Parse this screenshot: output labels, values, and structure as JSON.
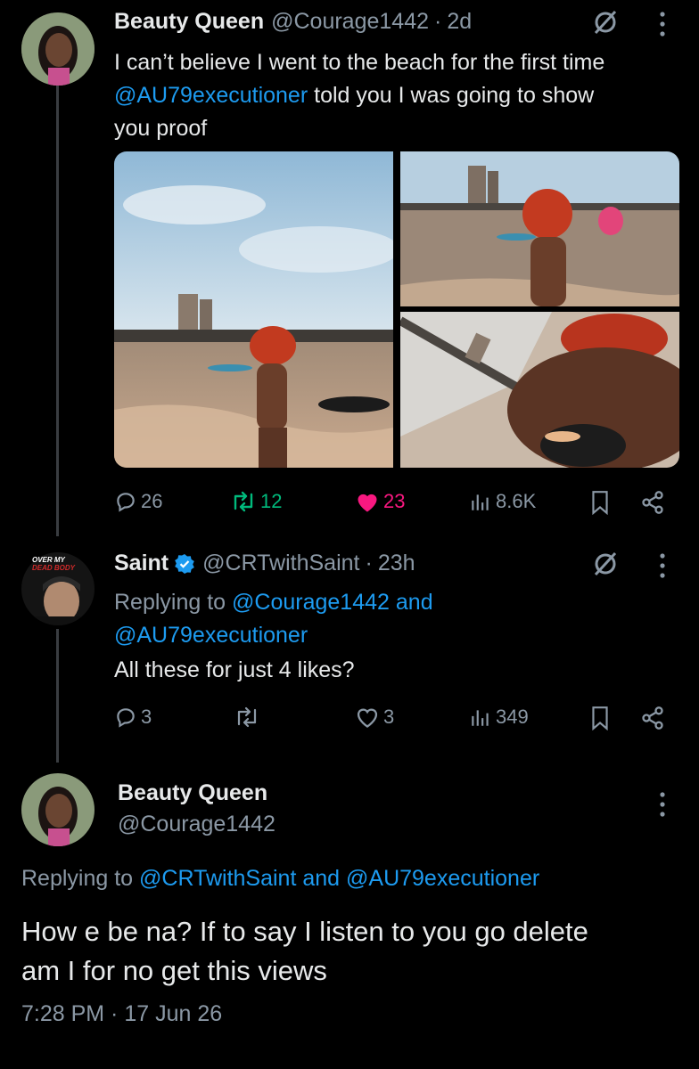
{
  "tweet1": {
    "name": "Beauty Queen",
    "handle": "@Courage1442",
    "dot": "·",
    "time": "2d",
    "text_line1": "I can’t believe I went to the beach for the first time",
    "mention": "@AU79executioner",
    "text_line2_rest": " told you I was going to show",
    "text_line3": "you proof",
    "replies": "26",
    "retweets": "12",
    "likes": "23",
    "views": "8.6K"
  },
  "tweet2": {
    "name": "Saint",
    "handle": "@CRTwithSaint",
    "dot": "·",
    "time": "23h",
    "replying_prefix": "Replying to ",
    "replying_to1": "@Courage1442",
    "replying_and": " and",
    "replying_to2": "@AU79executioner",
    "text": "All these for just 4 likes?",
    "avatar_badge_top": "OVER MY",
    "avatar_badge_bottom": "DEAD BODY",
    "replies": "3",
    "retweets": "",
    "likes": "3",
    "views": "349"
  },
  "tweet3": {
    "name": "Beauty Queen",
    "handle": "@Courage1442",
    "replying_prefix": "Replying to ",
    "replying_to1": "@CRTwithSaint",
    "replying_and": " and ",
    "replying_to2": "@AU79executioner",
    "text_line1": "How e be na? If to say I listen to you go delete",
    "text_line2": "am I for no get this views",
    "timestamp": "7:28 PM · 17 Jun 26"
  },
  "colors": {
    "background": "#000000",
    "text": "#e7e9ea",
    "muted": "#8b98a5",
    "link": "#1d9bf0",
    "retweet": "#00ba7c",
    "like": "#f91880",
    "verified": "#1d9bf0"
  },
  "icons": [
    "grok-icon",
    "more-icon",
    "reply-icon",
    "retweet-icon",
    "like-icon",
    "views-icon",
    "bookmark-icon",
    "share-icon",
    "verified-icon"
  ]
}
